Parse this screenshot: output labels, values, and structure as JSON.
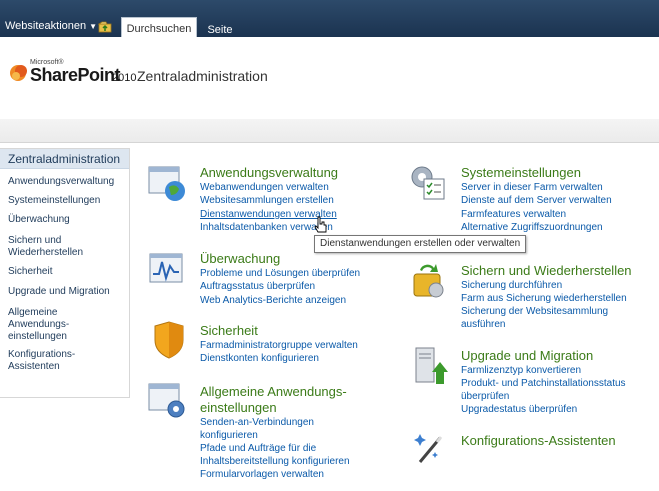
{
  "ribbon": {
    "site_actions": "Websiteaktionen",
    "tabs": [
      "Durchsuchen",
      "Seite"
    ]
  },
  "header": {
    "logo_microsoft": "Microsoft®",
    "logo_product": "SharePoint",
    "logo_version": "2010",
    "site_title": "Zentraladministration"
  },
  "leftnav": {
    "active": "Zentraladministration",
    "items": [
      "Anwendungsverwaltung",
      "Systemeinstellungen",
      "Überwachung",
      "Sichern und Wiederherstellen",
      "Sicherheit",
      "Upgrade und Migration",
      "Allgemeine Anwendungs-einstellungen",
      "Konfigurations-Assistenten"
    ]
  },
  "sections": {
    "anwendungsverwaltung": {
      "title": "Anwendungsverwaltung",
      "links": [
        "Webanwendungen verwalten",
        "Websitesammlungen erstellen",
        "Dienstanwendungen verwalten",
        "Inhaltsdatenbanken verwalten"
      ]
    },
    "ueberwachung": {
      "title": "Überwachung",
      "links": [
        "Probleme und Lösungen überprüfen",
        "Auftragsstatus überprüfen",
        "Web Analytics-Berichte anzeigen"
      ]
    },
    "sicherheit": {
      "title": "Sicherheit",
      "links": [
        "Farmadministratorgruppe verwalten",
        "Dienstkonten konfigurieren"
      ]
    },
    "allgemeine": {
      "title_line1": "Allgemeine Anwendungs-",
      "title_line2": "einstellungen",
      "links": [
        "Senden-an-Verbindungen",
        "konfigurieren",
        "Pfade und Aufträge für die",
        "Inhaltsbereitstellung konfigurieren",
        "Formularvorlagen verwalten"
      ]
    },
    "systemeinstellungen": {
      "title": "Systemeinstellungen",
      "links": [
        "Server in dieser Farm verwalten",
        "Dienste auf dem Server verwalten",
        "Farmfeatures verwalten",
        "Alternative Zugriffszuordnungen"
      ]
    },
    "sichern": {
      "title": "Sichern und Wiederherstellen",
      "links": [
        "Sicherung durchführen",
        "Farm aus Sicherung wiederherstellen",
        "Sicherung der Websitesammlung",
        "ausführen"
      ]
    },
    "upgrade": {
      "title": "Upgrade und Migration",
      "links": [
        "Farmlizenztyp konvertieren",
        "Produkt- und Patchinstallationsstatus",
        "überprüfen",
        "Upgradestatus überprüfen"
      ]
    },
    "konfiguration": {
      "title": "Konfigurations-Assistenten"
    }
  },
  "tooltip": "Dienstanwendungen erstellen oder verwalten",
  "colors": {
    "ribbon": "#1b3350",
    "title_green": "#3b7b18",
    "link_blue": "#0b5aa9"
  }
}
